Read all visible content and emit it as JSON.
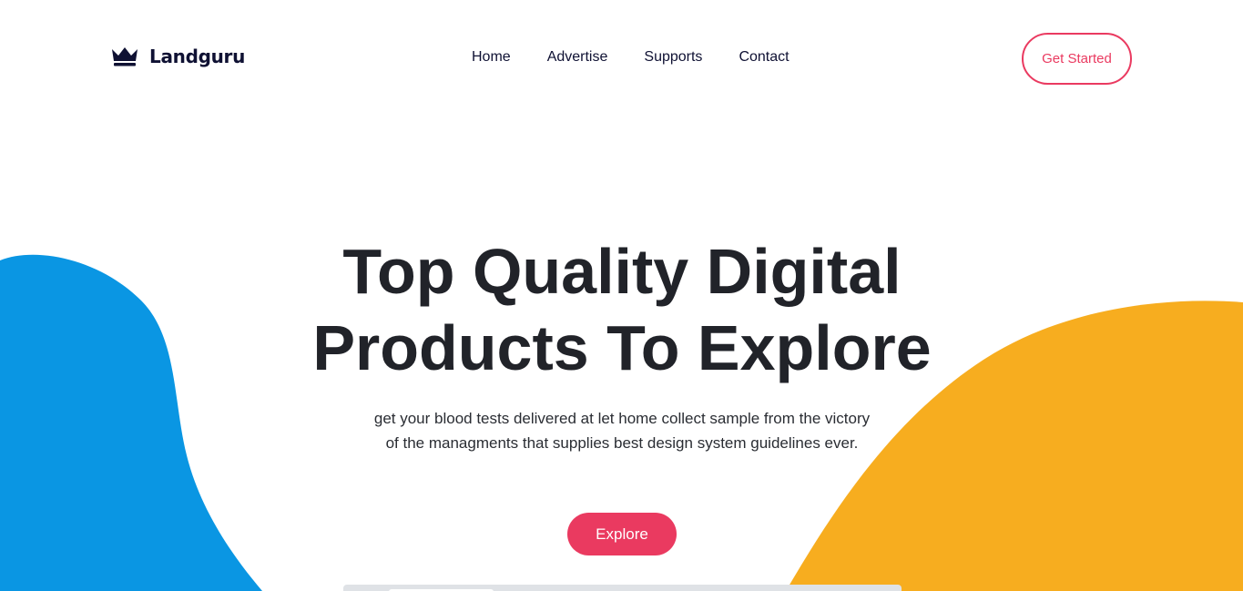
{
  "brand": {
    "name": "Landguru",
    "icon": "crown-icon",
    "color": "#0f1133"
  },
  "nav": {
    "items": [
      {
        "label": "Home"
      },
      {
        "label": "Advertise"
      },
      {
        "label": "Supports"
      },
      {
        "label": "Contact"
      }
    ]
  },
  "header": {
    "cta_label": "Get Started"
  },
  "hero": {
    "title": "Top Quality Digital Products To Explore",
    "subtitle": "get your blood tests delivered at let home collect sample from the victory of the managments that supplies best design system guidelines ever.",
    "button_label": "Explore"
  },
  "colors": {
    "accent": "#ea3a60",
    "blob_left": "#0a96e3",
    "blob_right": "#f7ad1f",
    "text_dark": "#212329"
  }
}
